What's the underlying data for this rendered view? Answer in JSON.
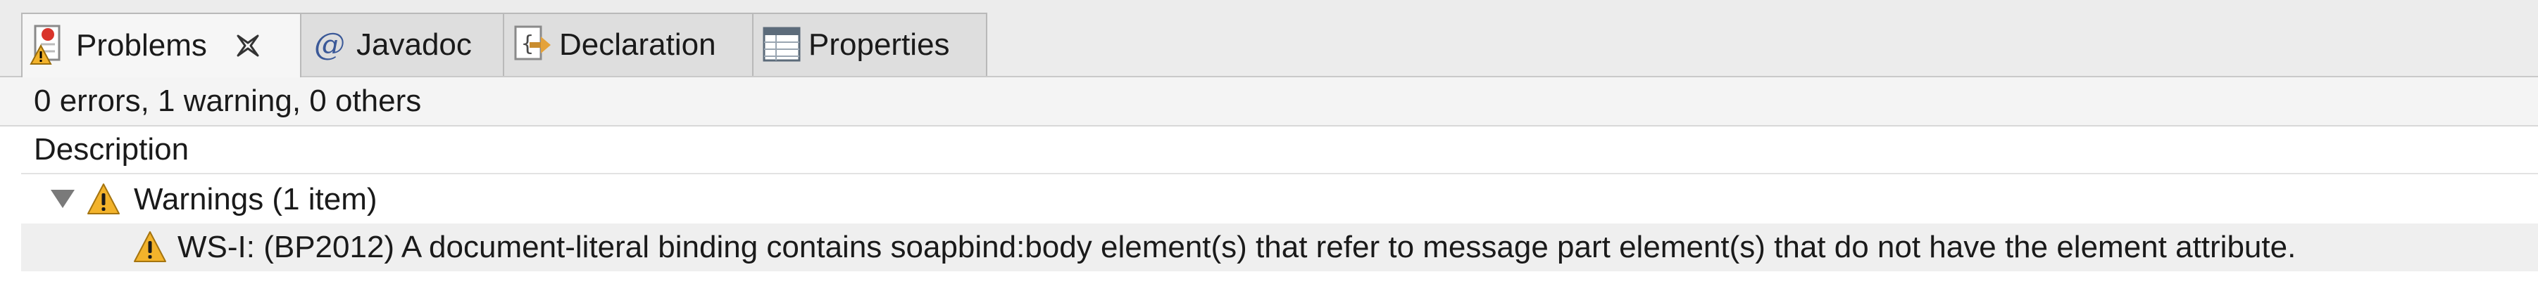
{
  "tabs": [
    {
      "label": "Problems",
      "icon": "problems-icon",
      "active": true,
      "closable": true
    },
    {
      "label": "Javadoc",
      "icon": "at-sign-icon",
      "active": false
    },
    {
      "label": "Declaration",
      "icon": "declaration-icon",
      "active": false
    },
    {
      "label": "Properties",
      "icon": "properties-table-icon",
      "active": false
    }
  ],
  "summary": "0 errors, 1 warning, 0 others",
  "table": {
    "column_header": "Description",
    "groups": [
      {
        "label": "Warnings (1 item)",
        "expanded": true,
        "icon": "warning-icon",
        "items": [
          {
            "text": "WS-I: (BP2012) A document-literal binding contains soapbind:body element(s) that refer to message part element(s) that do not have the element attribute.",
            "icon": "warning-icon"
          }
        ]
      }
    ]
  },
  "colors": {
    "warning": "#f3b32b",
    "tab_active_bg": "#f6f6f6",
    "tab_bg": "#dedede"
  }
}
